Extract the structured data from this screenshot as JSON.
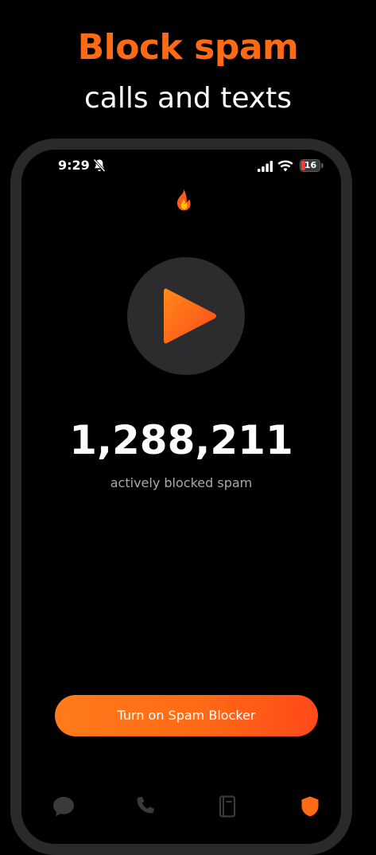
{
  "headline": {
    "primary": "Block spam",
    "secondary": "calls and texts"
  },
  "status_bar": {
    "time": "9:29",
    "battery_level": "16"
  },
  "main": {
    "blocked_count": "1,288,211",
    "blocked_caption": "actively blocked spam",
    "cta_label": "Turn on Spam Blocker"
  },
  "icons": {
    "status": [
      "bell-off-icon",
      "signal-icon",
      "wifi-icon",
      "battery-icon"
    ],
    "main": [
      "flame-icon",
      "play-icon"
    ],
    "tabs": [
      "chat-bubble-icon",
      "phone-icon",
      "book-icon",
      "shield-icon"
    ]
  },
  "colors": {
    "accent": "#ff6a15",
    "accent_end": "#ff4a1a",
    "circle": "#2c2c2e",
    "caption": "#a9a9ae",
    "tab_inactive": "#3a3a3c",
    "battery_low": "#ff3b30"
  }
}
